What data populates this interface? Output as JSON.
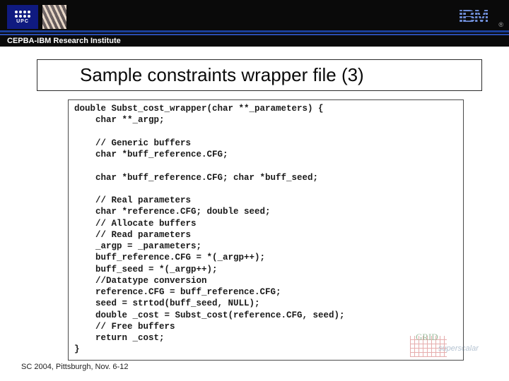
{
  "header": {
    "institute_bar": "CEPBA-IBM Research Institute",
    "reg_mark": "®"
  },
  "slide": {
    "title": "Sample constraints wrapper file (3)",
    "code": "double Subst_cost_wrapper(char **_parameters) {\n    char **_argp;\n\n    // Generic buffers\n    char *buff_reference.CFG;\n\n    char *buff_reference.CFG; char *buff_seed;\n\n    // Real parameters\n    char *reference.CFG; double seed;\n    // Allocate buffers\n    // Read parameters\n    _argp = _parameters;\n    buff_reference.CFG = *(_argp++);\n    buff_seed = *(_argp++);\n    //Datatype conversion\n    reference.CFG = buff_reference.CFG;\n    seed = strtod(buff_seed, NULL);\n    double _cost = Subst_cost(reference.CFG, seed);\n    // Free buffers\n    return _cost;\n}"
  },
  "footer": {
    "text": "SC 2004, Pittsburgh, Nov. 6-12"
  },
  "watermark": {
    "main": "GRID",
    "sub": "superscalar"
  }
}
